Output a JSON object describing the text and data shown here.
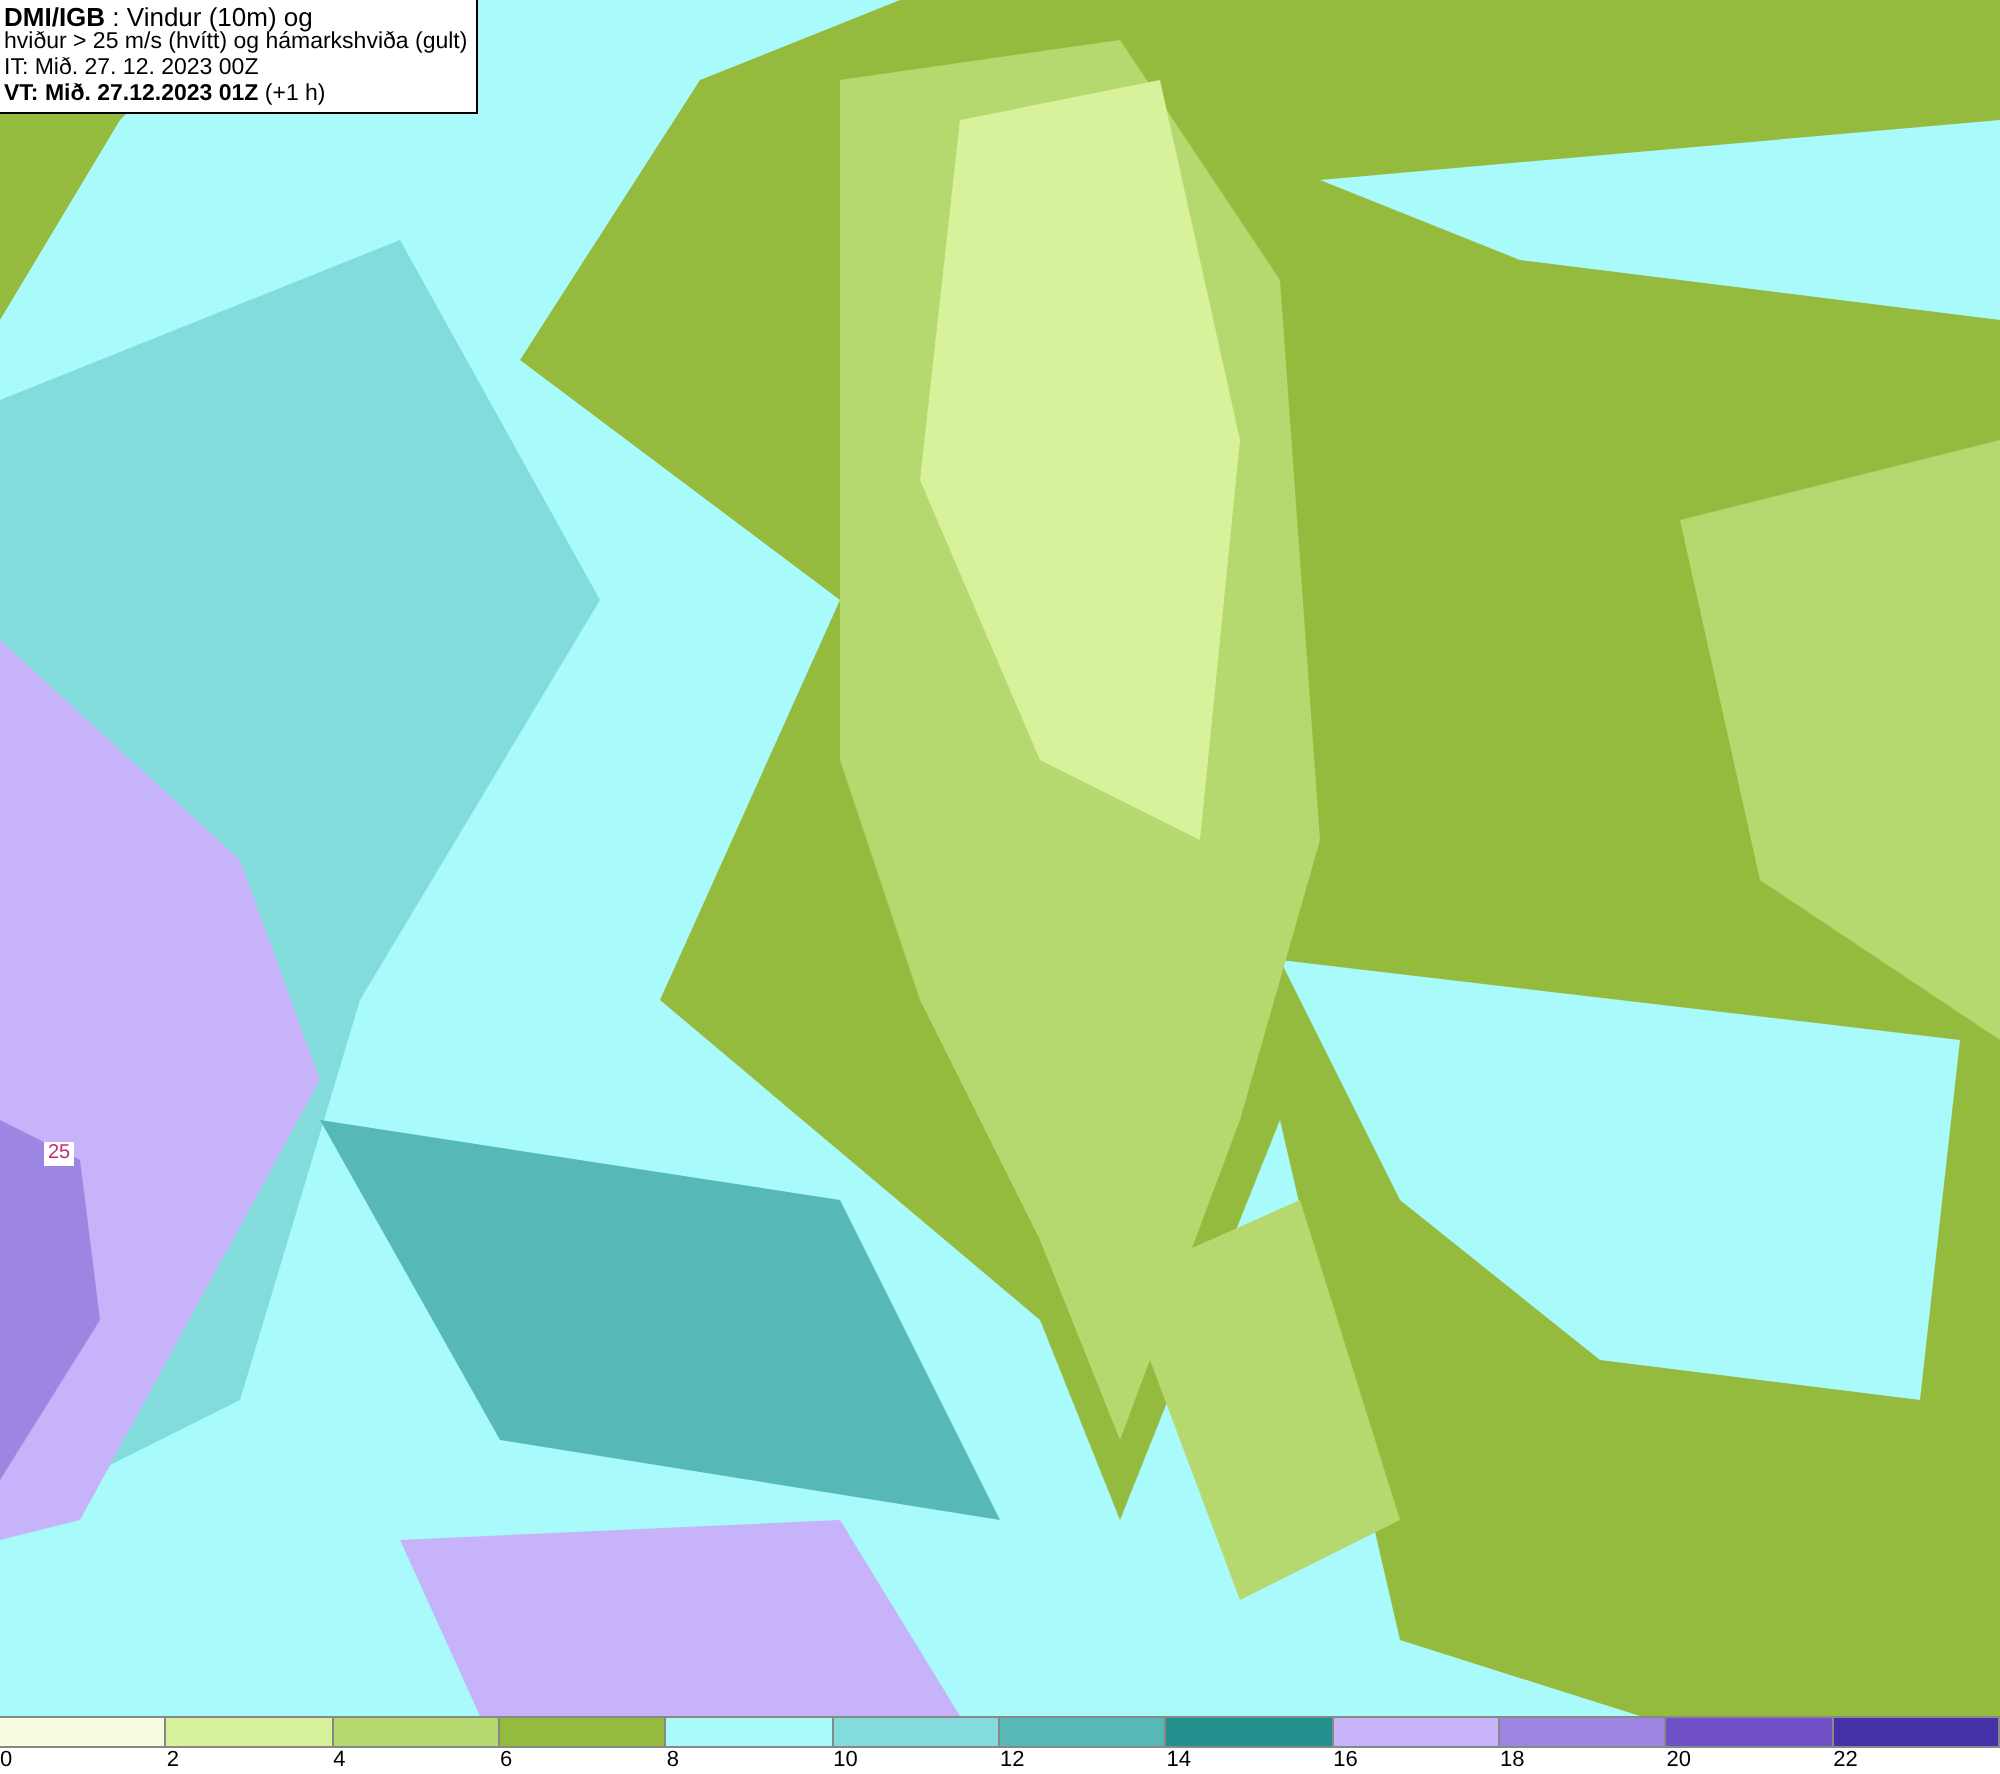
{
  "title_box": {
    "lines": [
      "**DMI/IGB** : Vindur (10m) og",
      "hviður > 25 m/s (hvítt) og hámarkshviða (gult)",
      "IT: Mið. 27. 12. 2023 00Z",
      "**VT: Mið. 27.12.2023 01Z** (+1 h)"
    ]
  },
  "map": {
    "contour_label": "25"
  },
  "legend": [
    {
      "label": "0",
      "color": "#f8fde0"
    },
    {
      "label": "2",
      "color": "#d8f29c"
    },
    {
      "label": "4",
      "color": "#b5d96e"
    },
    {
      "label": "6",
      "color": "#95bb3e"
    },
    {
      "label": "8",
      "color": "#a9fafa"
    },
    {
      "label": "10",
      "color": "#83dcdc"
    },
    {
      "label": "12",
      "color": "#57b8b8"
    },
    {
      "label": "14",
      "color": "#24908e"
    },
    {
      "label": "16",
      "color": "#c6b3fa"
    },
    {
      "label": "18",
      "color": "#9d85e2"
    },
    {
      "label": "20",
      "color": "#7050c5"
    },
    {
      "label": "22",
      "color": "#4630a8"
    }
  ]
}
